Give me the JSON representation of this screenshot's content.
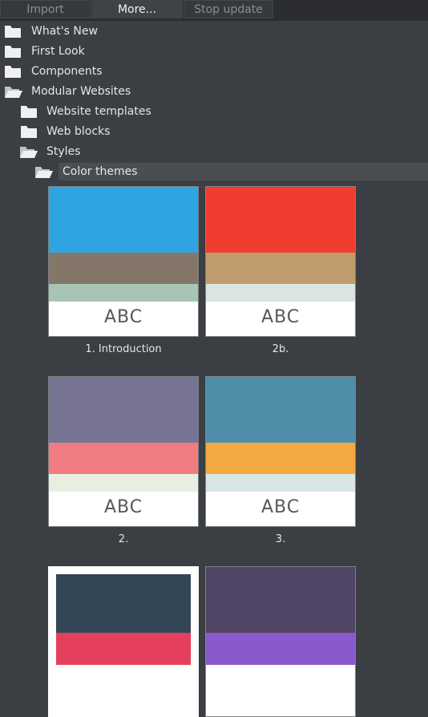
{
  "toolbar": {
    "import_label": "Import",
    "more_label": "More...",
    "stop_update_label": "Stop update"
  },
  "tree": {
    "items": [
      {
        "label": "What's New",
        "icon": "folder-closed-icon"
      },
      {
        "label": "First Look",
        "icon": "folder-closed-icon"
      },
      {
        "label": "Components",
        "icon": "folder-closed-icon"
      },
      {
        "label": "Modular Websites",
        "icon": "folder-open-icon"
      },
      {
        "label": "Website templates",
        "icon": "folder-closed-icon"
      },
      {
        "label": "Web blocks",
        "icon": "folder-closed-icon"
      },
      {
        "label": "Styles",
        "icon": "folder-open-icon"
      },
      {
        "label": "Color themes",
        "icon": "folder-open-icon"
      }
    ]
  },
  "themes": [
    {
      "caption": "1. Introduction",
      "sample": "ABC",
      "colors": [
        "#2fa4e3",
        "#85766a",
        "#a7c4b4"
      ]
    },
    {
      "caption": "2b.",
      "sample": "ABC",
      "colors": [
        "#f03d2f",
        "#be9c6b",
        "#d9e5e3"
      ]
    },
    {
      "caption": "2.",
      "sample": "ABC",
      "colors": [
        "#767393",
        "#f07b80",
        "#e8efe0"
      ]
    },
    {
      "caption": "3.",
      "sample": "ABC",
      "colors": [
        "#508da9",
        "#f3a941",
        "#d8e6e5"
      ]
    },
    {
      "caption": "",
      "sample": "",
      "colors": [
        "#334655",
        "#e43f5d"
      ]
    },
    {
      "caption": "",
      "sample": "",
      "colors": [
        "#514565",
        "#8a5acd"
      ]
    }
  ]
}
